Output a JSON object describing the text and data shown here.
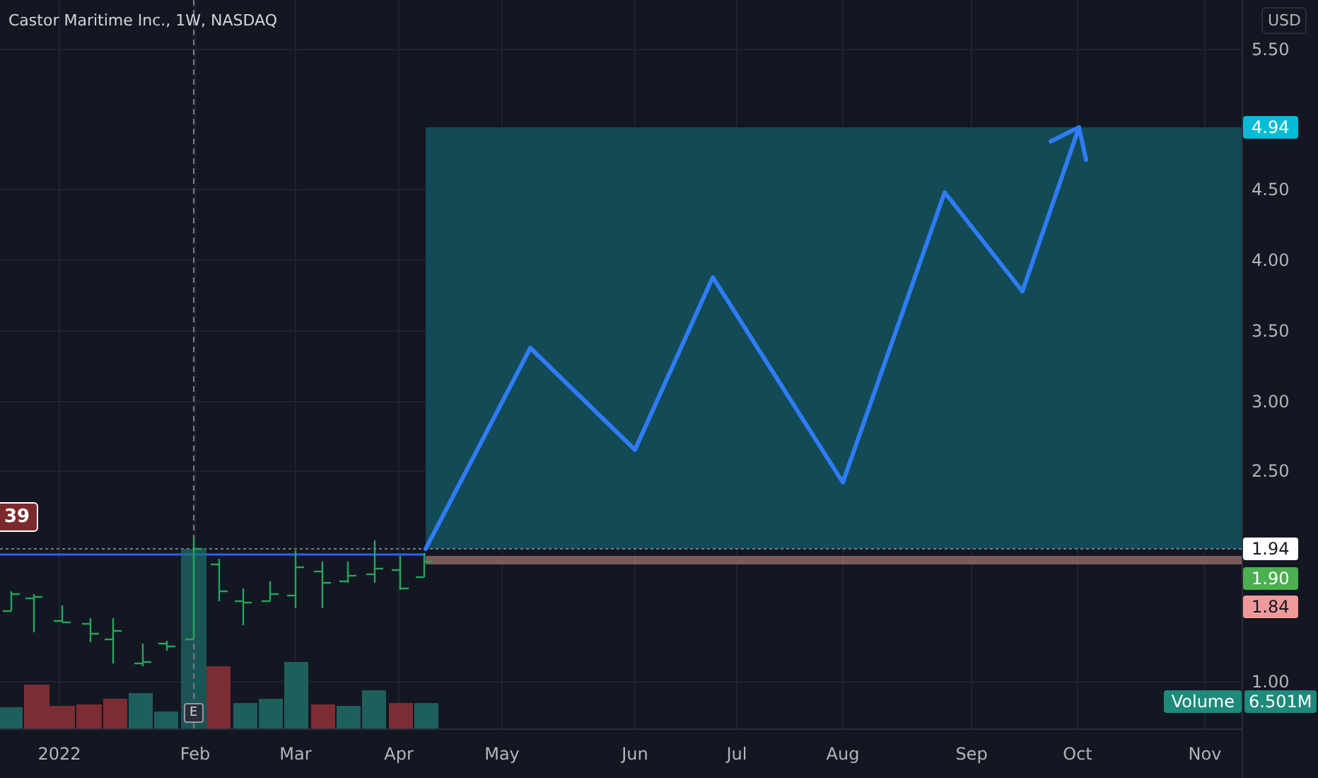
{
  "chart": {
    "title": "Castor Maritime Inc., 1W, NASDAQ",
    "currency": "USD",
    "price_ticks": [
      "5.50",
      "4.50",
      "4.00",
      "3.50",
      "3.00",
      "2.50",
      "1.00"
    ],
    "time_ticks": [
      "2022",
      "Feb",
      "Mar",
      "Apr",
      "May",
      "Jun",
      "Jul",
      "Aug",
      "Sep",
      "Oct",
      "Nov"
    ],
    "price_badges": [
      {
        "text": "4.94",
        "color": "#00bcd4"
      },
      {
        "text": "1.94",
        "color": "#ffffff"
      },
      {
        "text": "1.90",
        "color": "#4caf50"
      },
      {
        "text": "1.84",
        "color": "#ef9a9a"
      }
    ],
    "left_badge": "39",
    "earnings_marker": "E",
    "volume": {
      "label": "Volume",
      "value": "6.501M"
    }
  }
}
